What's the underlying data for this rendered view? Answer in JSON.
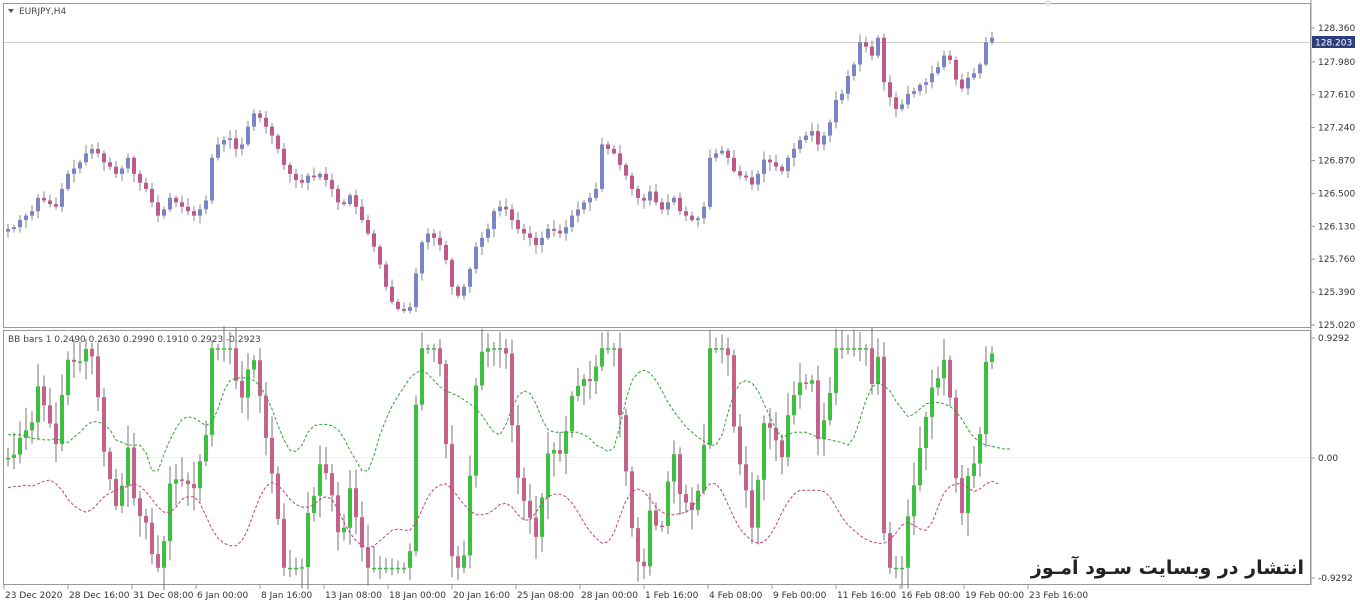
{
  "window": {
    "symbol_title": "EURJPY,H4"
  },
  "indicator": {
    "title": "BB bars 1 0.2490 0.2630 0.2990 0.1910 0.2923 -0.2923"
  },
  "current_price": "128.203",
  "watermark": "انتشار در وبسایت سـود آمـوز",
  "colors": {
    "bull": "#7b84c4",
    "bear": "#c0588a",
    "osc_bull": "#3fbf3f",
    "osc_bear": "#c4628c",
    "upper_band": "#2aa52a",
    "lower_band": "#c0407a",
    "grid": "#cccccc"
  },
  "chart_data": [
    {
      "type": "candlestick",
      "title": "EURJPY,H4",
      "ylim": [
        125.02,
        128.36
      ],
      "y_ticks": [
        "128.360",
        "127.980",
        "127.610",
        "127.240",
        "126.870",
        "126.500",
        "126.130",
        "125.760",
        "125.390",
        "125.020"
      ],
      "x_ticks": [
        "23 Dec 2020",
        "28 Dec 16:00",
        "31 Dec 08:00",
        "6 Jan 00:00",
        "8 Jan 16:00",
        "13 Jan 08:00",
        "18 Jan 00:00",
        "20 Jan 16:00",
        "25 Jan 08:00",
        "28 Jan 00:00",
        "1 Feb 16:00",
        "4 Feb 08:00",
        "9 Feb 00:00",
        "11 Feb 16:00",
        "16 Feb 08:00",
        "19 Feb 00:00",
        "23 Feb 16:00"
      ],
      "close": [
        126.1,
        126.12,
        126.2,
        126.25,
        126.3,
        126.45,
        126.42,
        126.38,
        126.35,
        126.55,
        126.72,
        126.78,
        126.85,
        126.95,
        127.0,
        126.95,
        126.85,
        126.8,
        126.72,
        126.78,
        126.9,
        126.72,
        126.62,
        126.55,
        126.4,
        126.25,
        126.32,
        126.45,
        126.4,
        126.35,
        126.3,
        126.25,
        126.32,
        126.42,
        126.9,
        127.05,
        127.1,
        127.12,
        127.0,
        127.05,
        127.25,
        127.4,
        127.35,
        127.25,
        127.15,
        127.0,
        126.82,
        126.72,
        126.65,
        126.62,
        126.7,
        126.68,
        126.72,
        126.65,
        126.55,
        126.4,
        126.38,
        126.48,
        126.35,
        126.2,
        126.05,
        125.9,
        125.7,
        125.45,
        125.28,
        125.2,
        125.18,
        125.22,
        125.6,
        125.95,
        126.05,
        126.0,
        125.92,
        125.75,
        125.45,
        125.35,
        125.45,
        125.65,
        125.9,
        126.0,
        126.1,
        126.3,
        126.35,
        126.32,
        126.2,
        126.1,
        126.05,
        126.0,
        125.92,
        126.0,
        126.1,
        126.08,
        126.05,
        126.12,
        126.25,
        126.32,
        126.4,
        126.45,
        126.55,
        127.05,
        127.0,
        126.95,
        126.82,
        126.7,
        126.55,
        126.45,
        126.42,
        126.52,
        126.4,
        126.32,
        126.4,
        126.45,
        126.3,
        126.25,
        126.2,
        126.22,
        126.35,
        126.9,
        126.95,
        126.98,
        126.9,
        126.75,
        126.7,
        126.68,
        126.6,
        126.72,
        126.88,
        126.85,
        126.8,
        126.75,
        126.9,
        127.0,
        127.1,
        127.15,
        127.2,
        127.05,
        127.15,
        127.3,
        127.55,
        127.62,
        127.82,
        127.95,
        128.2,
        128.15,
        128.05,
        128.25,
        127.75,
        127.58,
        127.45,
        127.5,
        127.62,
        127.65,
        127.72,
        127.75,
        127.85,
        127.92,
        128.05,
        128.0,
        127.78,
        127.68,
        127.8,
        127.85,
        127.95,
        128.2,
        128.25
      ]
    },
    {
      "type": "oscillator_bars",
      "title": "BB bars 1",
      "ylim": [
        -0.9292,
        0.9292
      ],
      "y_ticks": [
        "0.9292",
        "0.00",
        "-0.9292"
      ],
      "upper_band": [
        0.18,
        0.18,
        0.18,
        0.17,
        0.15,
        0.15,
        0.14,
        0.14,
        0.15,
        0.13,
        0.12,
        0.16,
        0.2,
        0.25,
        0.28,
        0.28,
        0.26,
        0.22,
        0.14,
        0.12,
        0.1,
        0.1,
        0.1,
        0.04,
        -0.1,
        -0.1,
        0.03,
        0.14,
        0.23,
        0.3,
        0.32,
        0.31,
        0.28,
        0.25,
        0.28,
        0.38,
        0.52,
        0.6,
        0.62,
        0.62,
        0.62,
        0.6,
        0.56,
        0.48,
        0.38,
        0.25,
        0.14,
        0.06,
        0.05,
        0.1,
        0.2,
        0.25,
        0.26,
        0.26,
        0.25,
        0.22,
        0.15,
        0.06,
        -0.02,
        -0.1,
        -0.1,
        0.02,
        0.18,
        0.3,
        0.4,
        0.48,
        0.55,
        0.62,
        0.66,
        0.68,
        0.65,
        0.6,
        0.55,
        0.52,
        0.5,
        0.48,
        0.45,
        0.42,
        0.38,
        0.33,
        0.26,
        0.2,
        0.18,
        0.26,
        0.38,
        0.48,
        0.52,
        0.5,
        0.42,
        0.3,
        0.22,
        0.2,
        0.2,
        0.2,
        0.2,
        0.2,
        0.18,
        0.15,
        0.1,
        0.08,
        0.05,
        0.08,
        0.25,
        0.45,
        0.6,
        0.66,
        0.68,
        0.66,
        0.6,
        0.52,
        0.43,
        0.36,
        0.3,
        0.24,
        0.2,
        0.16,
        0.13,
        0.1,
        0.1,
        0.18,
        0.35,
        0.5,
        0.58,
        0.6,
        0.58,
        0.52,
        0.42,
        0.32,
        0.22,
        0.16,
        0.18,
        0.2,
        0.2,
        0.2,
        0.18,
        0.16,
        0.15,
        0.14,
        0.13,
        0.12,
        0.1,
        0.16,
        0.3,
        0.45,
        0.55,
        0.58,
        0.56,
        0.52,
        0.44,
        0.38,
        0.32,
        0.34,
        0.38,
        0.42,
        0.43,
        0.43,
        0.42,
        0.4,
        0.36,
        0.3,
        0.22,
        0.16,
        0.12,
        0.1,
        0.09,
        0.08,
        0.07,
        0.07
      ],
      "lower_band": [
        -0.23,
        -0.22,
        -0.22,
        -0.21,
        -0.22,
        -0.2,
        -0.18,
        -0.17,
        -0.2,
        -0.25,
        -0.32,
        -0.37,
        -0.4,
        -0.42,
        -0.4,
        -0.35,
        -0.3,
        -0.27,
        -0.25,
        -0.23,
        -0.22,
        -0.2,
        -0.22,
        -0.26,
        -0.32,
        -0.38,
        -0.42,
        -0.42,
        -0.38,
        -0.32,
        -0.3,
        -0.3,
        -0.35,
        -0.45,
        -0.55,
        -0.62,
        -0.66,
        -0.68,
        -0.68,
        -0.64,
        -0.55,
        -0.42,
        -0.3,
        -0.22,
        -0.19,
        -0.21,
        -0.26,
        -0.32,
        -0.36,
        -0.38,
        -0.38,
        -0.36,
        -0.32,
        -0.3,
        -0.32,
        -0.4,
        -0.5,
        -0.58,
        -0.64,
        -0.68,
        -0.7,
        -0.68,
        -0.64,
        -0.6,
        -0.56,
        -0.55,
        -0.56,
        -0.56,
        -0.5,
        -0.4,
        -0.3,
        -0.24,
        -0.21,
        -0.2,
        -0.24,
        -0.3,
        -0.36,
        -0.41,
        -0.44,
        -0.44,
        -0.43,
        -0.4,
        -0.36,
        -0.35,
        -0.38,
        -0.44,
        -0.48,
        -0.48,
        -0.42,
        -0.35,
        -0.3,
        -0.28,
        -0.28,
        -0.3,
        -0.35,
        -0.42,
        -0.5,
        -0.57,
        -0.62,
        -0.66,
        -0.65,
        -0.58,
        -0.45,
        -0.33,
        -0.26,
        -0.24,
        -0.26,
        -0.32,
        -0.38,
        -0.42,
        -0.44,
        -0.44,
        -0.43,
        -0.42,
        -0.38,
        -0.32,
        -0.25,
        -0.2,
        -0.2,
        -0.26,
        -0.36,
        -0.46,
        -0.55,
        -0.6,
        -0.64,
        -0.66,
        -0.65,
        -0.6,
        -0.52,
        -0.42,
        -0.34,
        -0.28,
        -0.25,
        -0.25,
        -0.25,
        -0.25,
        -0.26,
        -0.3,
        -0.38,
        -0.46,
        -0.52,
        -0.56,
        -0.6,
        -0.63,
        -0.65,
        -0.66,
        -0.66,
        -0.63,
        -0.58,
        -0.52,
        -0.5,
        -0.52,
        -0.55,
        -0.56,
        -0.5,
        -0.38,
        -0.27,
        -0.22,
        -0.2,
        -0.2,
        -0.23,
        -0.26,
        -0.24,
        -0.2,
        -0.18,
        -0.2
      ]
    }
  ]
}
